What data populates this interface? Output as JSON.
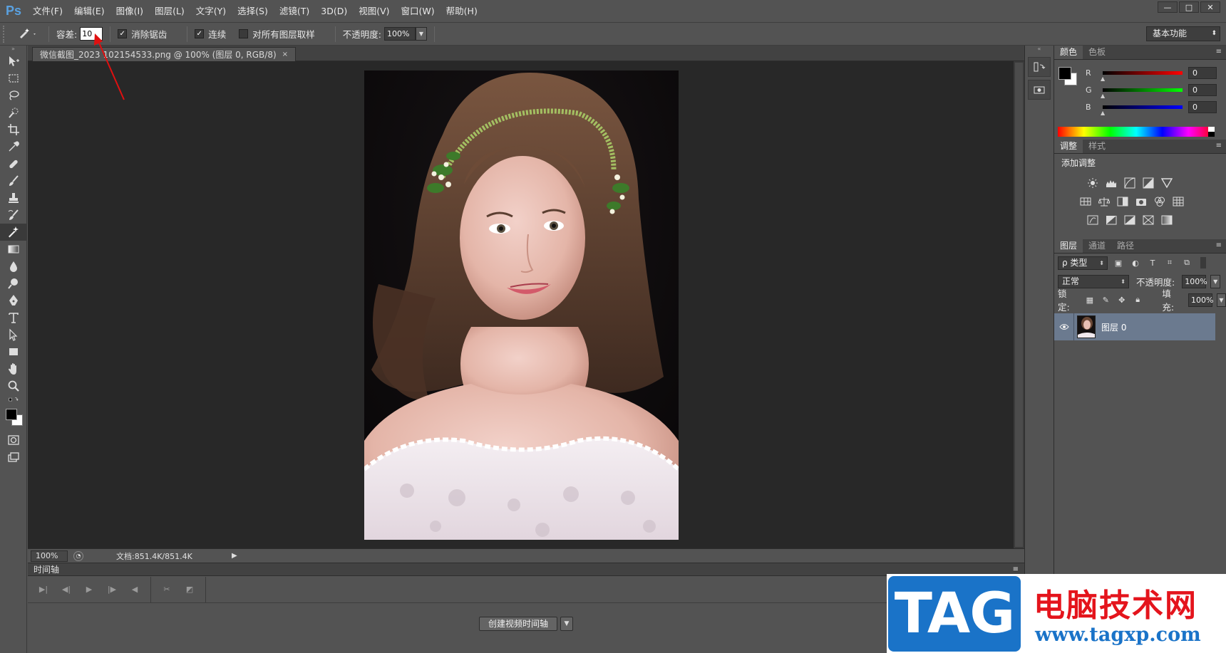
{
  "app": {
    "logo": "Ps"
  },
  "menu": [
    "文件(F)",
    "编辑(E)",
    "图像(I)",
    "图层(L)",
    "文字(Y)",
    "选择(S)",
    "滤镜(T)",
    "3D(D)",
    "视图(V)",
    "窗口(W)",
    "帮助(H)"
  ],
  "window_buttons": [
    "—",
    "□",
    "✕"
  ],
  "options": {
    "tolerance_label": "容差:",
    "tolerance_value": "10",
    "antialias_label": "消除锯齿",
    "antialias_checked": true,
    "contiguous_label": "连续",
    "contiguous_checked": true,
    "sample_all_label": "对所有图层取样",
    "sample_all_checked": false,
    "opacity_label": "不透明度:",
    "opacity_value": "100%",
    "workspace": "基本功能"
  },
  "document": {
    "tab_title": "微信截图_2023",
    "tab_suffix": "102154533.png @ 100% (图层 0, RGB/8)",
    "close": "×"
  },
  "status": {
    "zoom": "100%",
    "doc_info": "文档:851.4K/851.4K"
  },
  "timeline": {
    "title": "时间轴",
    "create_button": "创建视频时间轴"
  },
  "panels": {
    "color_tabs": [
      "颜色",
      "色板"
    ],
    "rgb": [
      {
        "label": "R",
        "value": "0",
        "color": "#ff0000"
      },
      {
        "label": "G",
        "value": "0",
        "color": "#00ff00"
      },
      {
        "label": "B",
        "value": "0",
        "color": "#0000ff"
      }
    ],
    "adjust_tabs": [
      "调整",
      "样式"
    ],
    "adjust_title": "添加调整",
    "layers_tabs": [
      "图层",
      "通道",
      "路径"
    ],
    "kind_filter": "ρ 类型",
    "blend_mode": "正常",
    "opacity_label": "不透明度:",
    "opacity_value": "100%",
    "lock_label": "锁定:",
    "fill_label": "填充:",
    "fill_value": "100%",
    "layer_name": "图层 0"
  },
  "watermark": {
    "badge": "TAG",
    "title": "电脑技术网",
    "url": "www.tagxp.com"
  },
  "colors": {
    "accent": "#1a73c8",
    "brand_red": "#e4141c",
    "selected_layer": "#6b7a8f"
  }
}
